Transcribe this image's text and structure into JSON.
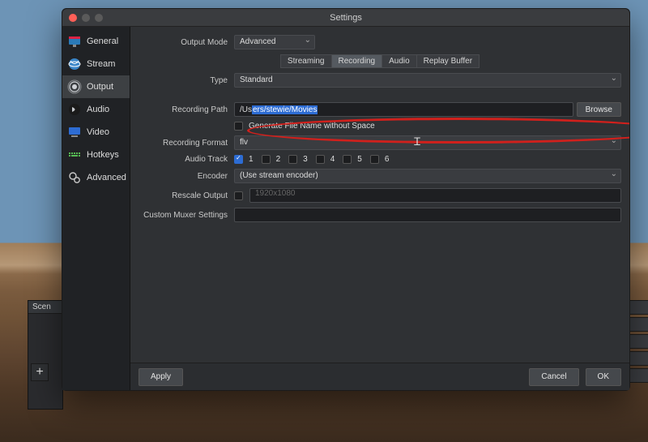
{
  "window": {
    "title": "Settings"
  },
  "sidebar": {
    "items": [
      {
        "label": "General"
      },
      {
        "label": "Stream"
      },
      {
        "label": "Output"
      },
      {
        "label": "Audio"
      },
      {
        "label": "Video"
      },
      {
        "label": "Hotkeys"
      },
      {
        "label": "Advanced"
      }
    ]
  },
  "output": {
    "mode_label": "Output Mode",
    "mode_value": "Advanced",
    "tabs": {
      "streaming": "Streaming",
      "recording": "Recording",
      "audio": "Audio",
      "replay": "Replay Buffer"
    },
    "type_label": "Type",
    "type_value": "Standard",
    "rec_path_label": "Recording Path",
    "rec_path_prefix": "/Us",
    "rec_path_selected": "ers/stewie/Movies",
    "browse": "Browse",
    "gen_filename_label": "Generate File Name without Space",
    "rec_format_label": "Recording Format",
    "rec_format_value": "flv",
    "audio_track_label": "Audio Track",
    "tracks": [
      "1",
      "2",
      "3",
      "4",
      "5",
      "6"
    ],
    "encoder_label": "Encoder",
    "encoder_value": "(Use stream encoder)",
    "rescale_label": "Rescale Output",
    "rescale_value": "1920x1080",
    "muxer_label": "Custom Muxer Settings"
  },
  "buttons": {
    "apply": "Apply",
    "cancel": "Cancel",
    "ok": "OK"
  },
  "background": {
    "scenes": "Scen"
  }
}
